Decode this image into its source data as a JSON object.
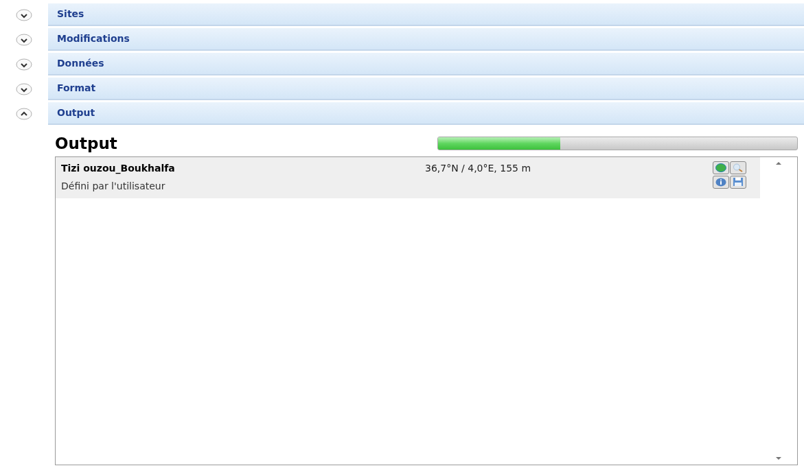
{
  "sections": [
    {
      "title": "Sites",
      "expanded": false
    },
    {
      "title": "Modifications",
      "expanded": false
    },
    {
      "title": "Données",
      "expanded": false
    },
    {
      "title": "Format",
      "expanded": false
    },
    {
      "title": "Output",
      "expanded": true
    }
  ],
  "output": {
    "heading": "Output",
    "progress": {
      "level": 0.34
    },
    "items": [
      {
        "name": "Tizi ouzou_Boukhalfa",
        "coords": "36,7°N / 4,0°E, 155 m",
        "source": "Défini par l'utilisateur",
        "selected": true
      }
    ]
  }
}
